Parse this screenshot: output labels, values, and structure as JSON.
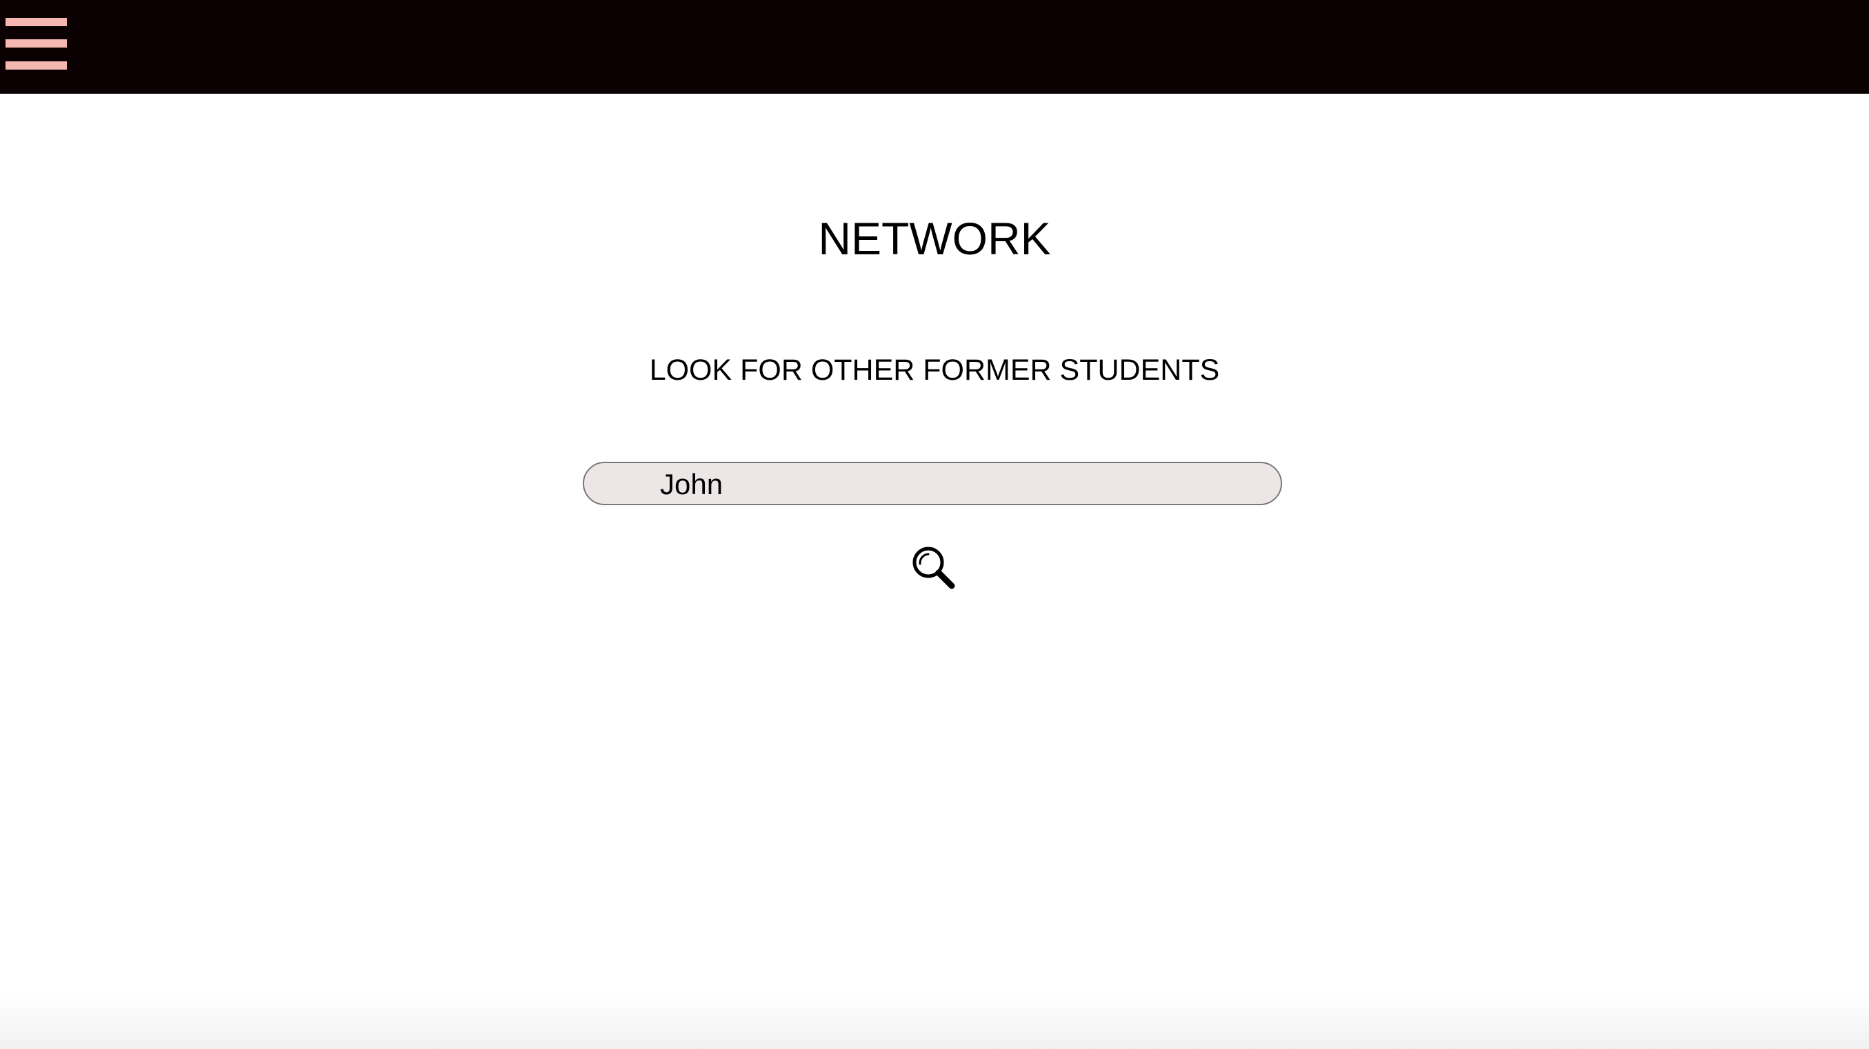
{
  "header": {
    "menu_icon": "hamburger-menu-icon",
    "background_color": "#0b0102",
    "menu_icon_color": "#f4b8b0"
  },
  "main": {
    "title": "NETWORK",
    "subtitle": "LOOK FOR OTHER FORMER STUDENTS",
    "search": {
      "value": "John ",
      "field_color": "#ede6e7"
    },
    "search_button_icon": "search-icon"
  }
}
